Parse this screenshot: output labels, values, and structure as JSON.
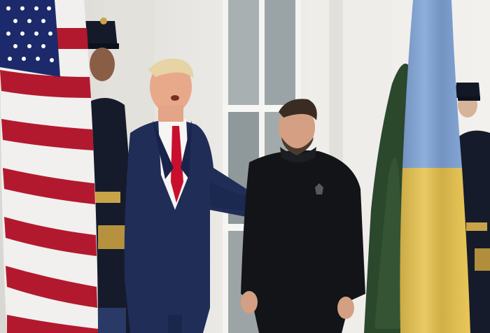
{
  "scene": {
    "subjects": [
      "american-flag",
      "honor-guard-left",
      "man-in-navy-suit",
      "man-in-black-shirt",
      "ukrainian-flag",
      "honor-guard-right"
    ],
    "colors": {
      "wall": "#e9e7e2",
      "window_frame": "#f4f4f2",
      "glass": "#9ea6a8",
      "suit_navy": "#1f2d57",
      "tie_red": "#c8102e",
      "black_shirt": "#121417",
      "flag_blue": "#7fa3d6",
      "flag_yellow": "#e6c24e",
      "us_red": "#b3192e",
      "us_blue": "#1c2a6b",
      "shrub": "#2e4a2e",
      "guard_uniform": "#151b2b",
      "brass": "#c9a347"
    }
  }
}
